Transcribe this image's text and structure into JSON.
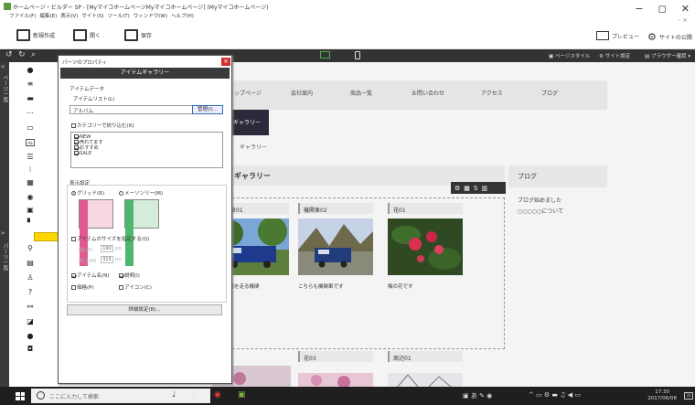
{
  "window": {
    "title": "ホームページ・ビルダー SP - [MyマイコホームページMyマイコホームページ] (Myマイコホームページ)",
    "menu": [
      "ファイル(F)",
      "編集(E)",
      "表示(V)",
      "サイト(S)",
      "ツール(T)",
      "ウィンドウ(W)",
      "ヘルプ(H)"
    ],
    "minimize": "−",
    "maximize": "◻",
    "close": "✕",
    "doc_close": "- ×"
  },
  "toolbar": {
    "new_label": "新規作成",
    "open_label": "開く",
    "save_label": "保存",
    "preview_label": "プレビュー",
    "site_publish_label": "サイトの公開"
  },
  "toolbar2": {
    "page_style": "ページスタイル",
    "site_settings": "サイト設定",
    "browser_check": "ブラウザー確認"
  },
  "leftbar": {
    "top_label": "ページ一覧",
    "bottom_label": "パーツ一覧"
  },
  "page_nav": [
    "トップページ",
    "会社案内",
    "商品一覧",
    "お問い合わせ",
    "アクセス",
    "ブログ"
  ],
  "page": {
    "tab_label": "ギャラリー",
    "tab_sub": "ギャラリー",
    "gallery_title": "ギャラリー",
    "blog_title": "ブログ",
    "blog_items": [
      "ブログ始めました",
      "○○○○○について"
    ]
  },
  "gallery_items": [
    {
      "title": "機関車01",
      "caption": "記念公園を走る機関"
    },
    {
      "title": "機関車02",
      "caption": "こちらも機関車です"
    },
    {
      "title": "花01",
      "caption": "梅の花です"
    }
  ],
  "gallery_items2": [
    {
      "title": "花03"
    },
    {
      "title": "周辺01"
    }
  ],
  "dialog": {
    "title": "パーツのプロパティ",
    "header": "アイテムギャラリー",
    "section_item": "アイテムデータ",
    "list_label": "アイテムリスト(L)",
    "list_value": "アルバム",
    "manage_button": "管理(I)...",
    "filter_label": "カテゴリーで絞り込む(K)",
    "categories": [
      "NEW",
      "売れてます",
      "おすすめ",
      "SALE"
    ],
    "section_display": "表示設定",
    "grid_label": "グリッド(R)",
    "mason_label": "メーソンリー(M)",
    "size_label": "アイテムのサイズを指定する(Q)",
    "width_label": "幅(W)",
    "width_value": "190",
    "height_label": "高さ(H)",
    "height_value": "315",
    "unit": "px",
    "name_label": "アイテム名(N)",
    "desc_label": "説明(I)",
    "price_label": "価格(P)",
    "icon_label": "アイコン(C)",
    "detail_button": "詳細設定(B)..."
  },
  "taskbar": {
    "search_placeholder": "ここに入力して検索",
    "time": "17:30",
    "date": "2017/06/08",
    "notif_count": "24"
  }
}
